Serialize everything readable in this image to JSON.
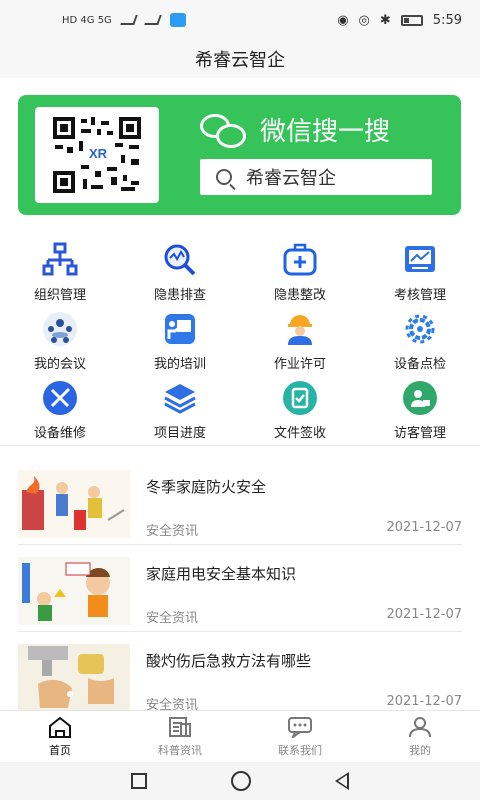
{
  "status_bar": {
    "left_text": "HD 4G 5G",
    "time": "5:59"
  },
  "app": {
    "title": "希睿云智企"
  },
  "banner": {
    "heading": "微信搜一搜",
    "search_text": "希睿云智企",
    "accent": "#35c35a"
  },
  "grid": [
    {
      "label": "组织管理",
      "icon": "org-chart-icon"
    },
    {
      "label": "隐患排查",
      "icon": "magnifier-icon"
    },
    {
      "label": "隐患整改",
      "icon": "medical-kit-icon"
    },
    {
      "label": "考核管理",
      "icon": "chart-board-icon"
    },
    {
      "label": "我的会议",
      "icon": "meeting-icon"
    },
    {
      "label": "我的培训",
      "icon": "training-icon"
    },
    {
      "label": "作业许可",
      "icon": "worker-icon"
    },
    {
      "label": "设备点检",
      "icon": "gear-icon"
    },
    {
      "label": "设备维修",
      "icon": "tools-icon"
    },
    {
      "label": "项目进度",
      "icon": "layers-icon"
    },
    {
      "label": "文件签收",
      "icon": "clipboard-icon"
    },
    {
      "label": "访客管理",
      "icon": "visitor-icon"
    }
  ],
  "news": [
    {
      "title": "冬季家庭防火安全",
      "tag": "安全资讯",
      "date": "2021-12-07"
    },
    {
      "title": "家庭用电安全基本知识",
      "tag": "安全资讯",
      "date": "2021-12-07"
    },
    {
      "title": "酸灼伤后急救方法有哪些",
      "tag": "安全资讯",
      "date": "2021-12-07"
    }
  ],
  "tabs": [
    {
      "label": "首页",
      "icon": "home-icon"
    },
    {
      "label": "科普资讯",
      "icon": "news-icon"
    },
    {
      "label": "联系我们",
      "icon": "chat-icon"
    },
    {
      "label": "我的",
      "icon": "person-icon"
    }
  ]
}
